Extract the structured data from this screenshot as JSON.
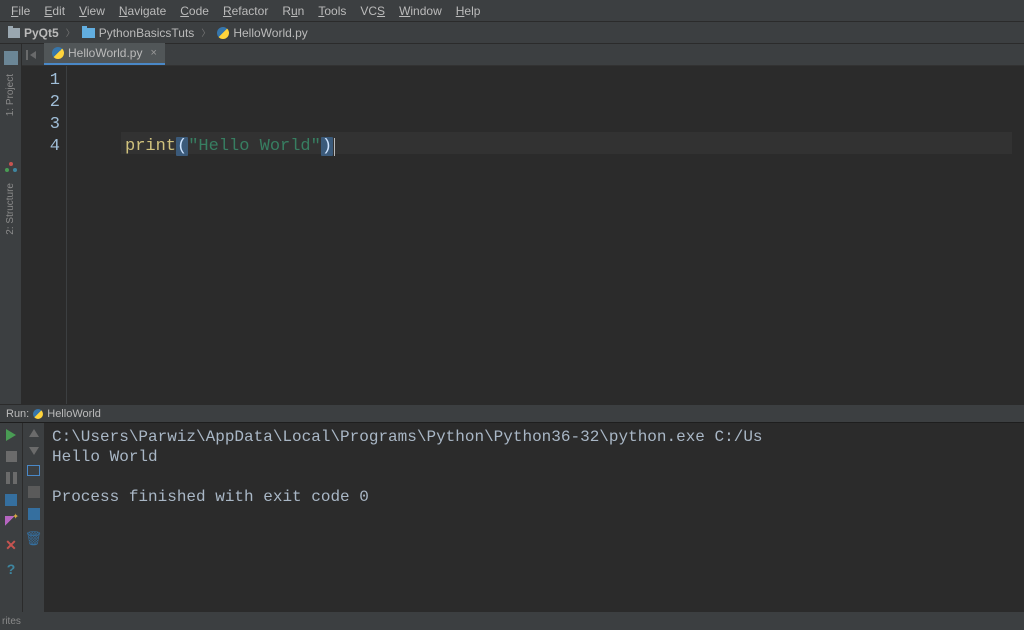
{
  "menu": {
    "file": "File",
    "edit": "Edit",
    "view": "View",
    "navigate": "Navigate",
    "code": "Code",
    "refactor": "Refactor",
    "run": "Run",
    "tools": "Tools",
    "vcs": "VCS",
    "window": "Window",
    "help": "Help"
  },
  "breadcrumb": {
    "root": "PyQt5",
    "folder": "PythonBasicsTuts",
    "file": "HelloWorld.py"
  },
  "left_tools": {
    "project": "1: Project",
    "structure": "2: Structure"
  },
  "tabs": {
    "active": "HelloWorld.py"
  },
  "editor": {
    "line_numbers": [
      "1",
      "2",
      "3",
      "4"
    ],
    "code_lines": {
      "l1": "",
      "l2": "",
      "l3": "",
      "l4_fn": "print",
      "l4_open": "(",
      "l4_str": "\"Hello World\"",
      "l4_close": ")"
    }
  },
  "run": {
    "label": "Run:",
    "config": "HelloWorld",
    "console_line1": "C:\\Users\\Parwiz\\AppData\\Local\\Programs\\Python\\Python36-32\\python.exe C:/Us",
    "console_line2": "Hello World",
    "console_line3": "",
    "console_line4": "Process finished with exit code 0"
  },
  "bottom": {
    "favorites": "rites"
  }
}
